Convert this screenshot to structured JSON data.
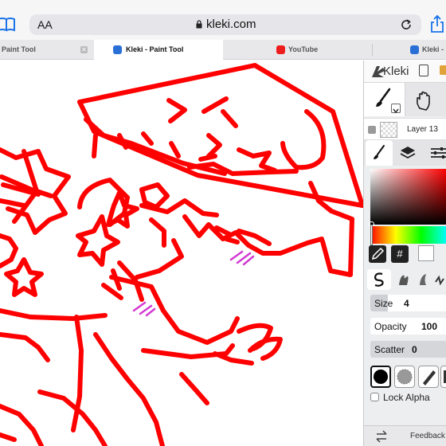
{
  "browser": {
    "url_text_size": "AA",
    "url": "kleki.com",
    "tabs": [
      {
        "label": "Paint Tool"
      },
      {
        "label": "Kleki - Paint Tool"
      },
      {
        "label": "YouTube"
      },
      {
        "label": "Kleki -"
      }
    ]
  },
  "panel": {
    "app_name": "Kleki",
    "layer_name": "Layer 13",
    "hex_label": "#",
    "size_label": "Size",
    "size_value": "4",
    "opacity_label": "Opacity",
    "opacity_value": "100",
    "scatter_label": "Scatter",
    "scatter_value": "0",
    "lock_alpha": "Lock Alpha",
    "feedback": "Feedback"
  },
  "colors": {
    "stroke": "#ff0000",
    "accent_magenta": "#d23ad2"
  }
}
